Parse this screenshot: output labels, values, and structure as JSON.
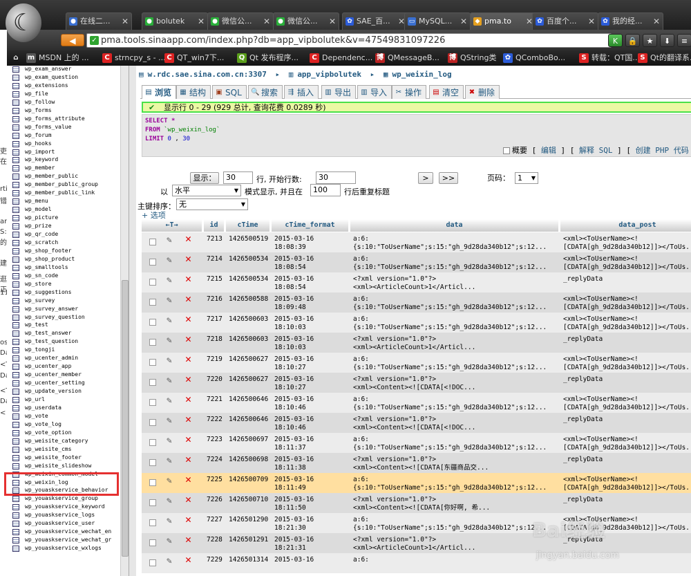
{
  "browser": {
    "tabs": [
      {
        "label": "在线二...",
        "icon": "page-icon",
        "color": "#3a6fd0",
        "glyph": "●"
      },
      {
        "label": "bolutek",
        "icon": "wechat-icon",
        "color": "#2aae3a",
        "glyph": "●"
      },
      {
        "label": "微信公...",
        "icon": "wechat-icon",
        "color": "#2aae3a",
        "glyph": "●"
      },
      {
        "label": "微信公...",
        "icon": "wechat-icon",
        "color": "#2aae3a",
        "glyph": "●"
      },
      {
        "label": "SAE_百...",
        "icon": "baidu-icon",
        "color": "#2b5bd8",
        "glyph": "✿"
      },
      {
        "label": "MySQL...",
        "icon": "page-icon",
        "color": "#3a6fd0",
        "glyph": "▭"
      },
      {
        "label": "pma.to",
        "icon": "pma-icon",
        "color": "#e5a020",
        "glyph": "◆"
      },
      {
        "label": "百度个...",
        "icon": "baidu-icon",
        "color": "#2b5bd8",
        "glyph": "✿"
      },
      {
        "label": "我的经...",
        "icon": "baidu-icon",
        "color": "#2b5bd8",
        "glyph": "✿"
      }
    ],
    "url": "pma.tools.sinaapp.com/index.php?db=app_vipbolutek&v=47549831097226",
    "bookmarks": [
      {
        "label": "MSDN 上的 ...",
        "icon": "msdn-icon",
        "color": "#555",
        "glyph": "m"
      },
      {
        "label": "strncpy_s - ...",
        "icon": "csdn-icon",
        "color": "#d22",
        "glyph": "C"
      },
      {
        "label": "QT_win7下...",
        "icon": "csdn-icon",
        "color": "#d22",
        "glyph": "C"
      },
      {
        "label": "Qt 发布程序...",
        "icon": "qt-icon",
        "color": "#5a9e1a",
        "glyph": "Q"
      },
      {
        "label": "Dependenc...",
        "icon": "csdn-icon",
        "color": "#d22",
        "glyph": "C"
      },
      {
        "label": "QMessageB...",
        "icon": "cnblogs-icon",
        "color": "#b22",
        "glyph": "博"
      },
      {
        "label": "QString类",
        "icon": "cnblogs-icon",
        "color": "#b22",
        "glyph": "博"
      },
      {
        "label": "QComboBo...",
        "icon": "baidu-icon",
        "color": "#2b5bd8",
        "glyph": "✿"
      },
      {
        "label": "转载：QT国...",
        "icon": "sina-icon",
        "color": "#d22",
        "glyph": "S"
      },
      {
        "label": "Qt的翻译系...",
        "icon": "sina-icon",
        "color": "#d22",
        "glyph": "S"
      }
    ],
    "behind_text": [
      "吏在",
      "rti",
      "错",
      "arti",
      "S:1",
      "的",
      "建",
      "逛正",
      "11",
      "ost",
      "Dat",
      "<T",
      "Dat",
      "<T",
      "Dat",
      "<"
    ]
  },
  "sidebar": {
    "tables": [
      "wp_exam_answer",
      "wp_exam_question",
      "wp_extensions",
      "wp_file",
      "wp_follow",
      "wp_forms",
      "wp_forms_attribute",
      "wp_forms_value",
      "wp_forum",
      "wp_hooks",
      "wp_import",
      "wp_keyword",
      "wp_member",
      "wp_member_public",
      "wp_member_public_group",
      "wp_member_public_link",
      "wp_menu",
      "wp_model",
      "wp_picture",
      "wp_prize",
      "wp_qr_code",
      "wp_scratch",
      "wp_shop_footer",
      "wp_shop_product",
      "wp_smalltools",
      "wp_sn_code",
      "wp_store",
      "wp_suggestions",
      "wp_survey",
      "wp_survey_answer",
      "wp_survey_question",
      "wp_test",
      "wp_test_answer",
      "wp_test_question",
      "wp_tongji",
      "wp_ucenter_admin",
      "wp_ucenter_app",
      "wp_ucenter_member",
      "wp_ucenter_setting",
      "wp_update_version",
      "wp_url",
      "wp_userdata",
      "wp_vote",
      "wp_vote_log",
      "wp_vote_option",
      "wp_weisite_category",
      "wp_weisite_cms",
      "wp_weisite_footer",
      "wp_weisite_slideshow",
      "wp_weixin_common_model",
      "wp_weixin_log",
      "wp_youaskservice_behavior",
      "wp_youaskservice_group",
      "wp_youaskservice_keyword",
      "wp_youaskservice_logs",
      "wp_youaskservice_user",
      "wp_youaskservice_wechat_en",
      "wp_youaskservice_wechat_gr",
      "wp_youaskservice_wxlogs"
    ]
  },
  "breadcrumb": {
    "server": "w.rdc.sae.sina.com.cn:3307",
    "database": "app_vipbolutek",
    "table": "wp_weixin_log"
  },
  "main_tabs": [
    {
      "label": "浏览",
      "glyph": "▤",
      "color": "#235a81"
    },
    {
      "label": "结构",
      "glyph": "▦",
      "color": "#235a81"
    },
    {
      "label": "SQL",
      "glyph": "▣",
      "color": "#a04020"
    },
    {
      "label": "搜索",
      "glyph": "🔍",
      "color": "#235a81"
    },
    {
      "label": "插入",
      "glyph": "⇶",
      "color": "#235a81"
    },
    {
      "label": "导出",
      "glyph": "▥",
      "color": "#235a81"
    },
    {
      "label": "导入",
      "glyph": "▥",
      "color": "#235a81"
    },
    {
      "label": "操作",
      "glyph": "✂",
      "color": "#235a81"
    },
    {
      "label": "清空",
      "glyph": "▤",
      "color": "#c00"
    },
    {
      "label": "删除",
      "glyph": "✖",
      "color": "#c00"
    }
  ],
  "status": "显示行 0 - 29 (929 总计, 查询花费 0.0289 秒)",
  "sql": {
    "select": "SELECT",
    "star": "*",
    "from": "FROM",
    "table": "`wp_weixin_log`",
    "limit": "LIMIT",
    "offset": "0",
    "count": "30"
  },
  "sql_tools": {
    "profile": "概要",
    "edit": "编辑",
    "explain": "解释 SQL",
    "php": "创建 PHP 代码",
    "sep_l": "[",
    "sep_r": "]"
  },
  "controls": {
    "show_btn": "显示：",
    "rows": "30",
    "rows_label": "行, 开始行数:",
    "start": "30",
    "next": ">",
    "last": ">>",
    "page_label": "页码：",
    "page": "1",
    "mode_prefix": "以",
    "mode": "水平",
    "mode_label": "模式显示, 并且在",
    "repeat": "100",
    "repeat_label": "行后重复标题",
    "sort_label": "主键排序：",
    "sort": "无",
    "options": "+ 选项"
  },
  "columns": [
    "←T→",
    "id",
    "cTime",
    "cTime_format",
    "data",
    "data_post"
  ],
  "rows": [
    {
      "id": "7213",
      "ctime": "1426500519",
      "fmt1": "2015-03-16",
      "fmt2": "18:08:39",
      "d1": "a:6:",
      "d2": "{s:10:\"ToUserName\";s:15:\"gh_9d28da340b12\";s:12...",
      "p1": "<xml><ToUserName><!",
      "p2": "[CDATA[gh_9d28da340b12]]></ToUs..."
    },
    {
      "id": "7214",
      "ctime": "1426500534",
      "fmt1": "2015-03-16",
      "fmt2": "18:08:54",
      "d1": "a:6:",
      "d2": "{s:10:\"ToUserName\";s:15:\"gh_9d28da340b12\";s:12...",
      "p1": "<xml><ToUserName><!",
      "p2": "[CDATA[gh_9d28da340b12]]></ToUs..."
    },
    {
      "id": "7215",
      "ctime": "1426500534",
      "fmt1": "2015-03-16",
      "fmt2": "18:08:54",
      "d1": "<?xml version=\"1.0\"?>",
      "d2": "<xml><ArticleCount>1</Articl...",
      "p1": "_replyData",
      "p2": ""
    },
    {
      "id": "7216",
      "ctime": "1426500588",
      "fmt1": "2015-03-16",
      "fmt2": "18:09:48",
      "d1": "a:6:",
      "d2": "{s:10:\"ToUserName\";s:15:\"gh_9d28da340b12\";s:12...",
      "p1": "<xml><ToUserName><!",
      "p2": "[CDATA[gh_9d28da340b12]]></ToUs..."
    },
    {
      "id": "7217",
      "ctime": "1426500603",
      "fmt1": "2015-03-16",
      "fmt2": "18:10:03",
      "d1": "a:6:",
      "d2": "{s:10:\"ToUserName\";s:15:\"gh_9d28da340b12\";s:12...",
      "p1": "<xml><ToUserName><!",
      "p2": "[CDATA[gh_9d28da340b12]]></ToUs..."
    },
    {
      "id": "7218",
      "ctime": "1426500603",
      "fmt1": "2015-03-16",
      "fmt2": "18:10:03",
      "d1": "<?xml version=\"1.0\"?>",
      "d2": "<xml><ArticleCount>1</Articl...",
      "p1": "_replyData",
      "p2": ""
    },
    {
      "id": "7219",
      "ctime": "1426500627",
      "fmt1": "2015-03-16",
      "fmt2": "18:10:27",
      "d1": "a:6:",
      "d2": "{s:10:\"ToUserName\";s:15:\"gh_9d28da340b12\";s:12...",
      "p1": "<xml><ToUserName><!",
      "p2": "[CDATA[gh_9d28da340b12]]></ToUs..."
    },
    {
      "id": "7220",
      "ctime": "1426500627",
      "fmt1": "2015-03-16",
      "fmt2": "18:10:27",
      "d1": "<?xml version=\"1.0\"?>",
      "d2": "<xml><Content><![CDATA[<!DOC...",
      "p1": "_replyData",
      "p2": ""
    },
    {
      "id": "7221",
      "ctime": "1426500646",
      "fmt1": "2015-03-16",
      "fmt2": "18:10:46",
      "d1": "a:6:",
      "d2": "{s:10:\"ToUserName\";s:15:\"gh_9d28da340b12\";s:12...",
      "p1": "<xml><ToUserName><!",
      "p2": "[CDATA[gh_9d28da340b12]]></ToUs..."
    },
    {
      "id": "7222",
      "ctime": "1426500646",
      "fmt1": "2015-03-16",
      "fmt2": "18:10:46",
      "d1": "<?xml version=\"1.0\"?>",
      "d2": "<xml><Content><![CDATA[<!DOC...",
      "p1": "_replyData",
      "p2": ""
    },
    {
      "id": "7223",
      "ctime": "1426500697",
      "fmt1": "2015-03-16",
      "fmt2": "18:11:37",
      "d1": "a:6:",
      "d2": "{s:10:\"ToUserName\";s:15:\"gh_9d28da340b12\";s:12...",
      "p1": "<xml><ToUserName><!",
      "p2": "[CDATA[gh_9d28da340b12]]></ToUs..."
    },
    {
      "id": "7224",
      "ctime": "1426500698",
      "fmt1": "2015-03-16",
      "fmt2": "18:11:38",
      "d1": "<?xml version=\"1.0\"?>",
      "d2": "<xml><Content><![CDATA[东疆商品交...",
      "p1": "_replyData",
      "p2": ""
    },
    {
      "id": "7225",
      "ctime": "1426500709",
      "fmt1": "2015-03-16",
      "fmt2": "18:11:49",
      "d1": "a:6:",
      "d2": "{s:10:\"ToUserName\";s:15:\"gh_9d28da340b12\";s:12...",
      "p1": "<xml><ToUserName><!",
      "p2": "[CDATA[gh_9d28da340b12]]></ToUs..."
    },
    {
      "id": "7226",
      "ctime": "1426500710",
      "fmt1": "2015-03-16",
      "fmt2": "18:11:50",
      "d1": "<?xml version=\"1.0\"?>",
      "d2": "<xml><Content><![CDATA[你好啊, 希...",
      "p1": "_replyData",
      "p2": ""
    },
    {
      "id": "7227",
      "ctime": "1426501290",
      "fmt1": "2015-03-16",
      "fmt2": "18:21:30",
      "d1": "a:6:",
      "d2": "{s:10:\"ToUserName\";s:15:\"gh_9d28da340b12\";s:12...",
      "p1": "<xml><ToUserName><!",
      "p2": "[CDATA[gh_9d28da340b12]]></ToUs..."
    },
    {
      "id": "7228",
      "ctime": "1426501291",
      "fmt1": "2015-03-16",
      "fmt2": "18:21:31",
      "d1": "<?xml version=\"1.0\"?>",
      "d2": "<xml><ArticleCount>1</Articl...",
      "p1": "_replyData",
      "p2": ""
    },
    {
      "id": "7229",
      "ctime": "1426501314",
      "fmt1": "2015-03-16",
      "fmt2": "",
      "d1": "a:6:",
      "d2": "",
      "p1": "",
      "p2": ""
    }
  ],
  "watermark": {
    "brand": "Bai经验",
    "site": "jingyan.baidu.com"
  }
}
